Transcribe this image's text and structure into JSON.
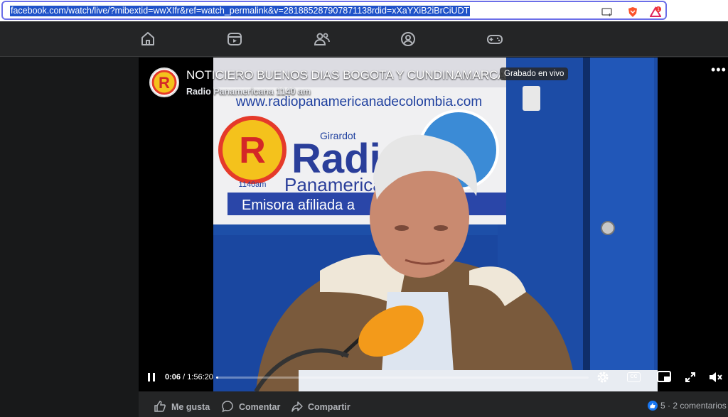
{
  "browser": {
    "url": "facebook.com/watch/live/?mibextid=wwXIfr&ref=watch_permalink&v=281885287907871138rdid=xXaYXiB2iBrCiUDT",
    "icons": [
      "install-app-icon",
      "brave-shield-icon",
      "brave-rewards-icon"
    ],
    "rewards_badge": "1"
  },
  "nav": {
    "items": [
      {
        "name": "home-icon"
      },
      {
        "name": "video-icon"
      },
      {
        "name": "friends-icon"
      },
      {
        "name": "profile-icon"
      },
      {
        "name": "gaming-icon"
      }
    ]
  },
  "video": {
    "title": "NOTICIERO BUENOS DIAS BOGOTA Y CUNDINAMARCA",
    "badge": "Grabado en vivo",
    "channel": "Radio Panamericana 1140 am",
    "more": "•••",
    "poster": {
      "url_text": "www.radiopanamericanadecolombia.com",
      "city": "Girardot",
      "brand_line1": "Radio",
      "brand_line2": "Panamericana",
      "frequency": "1140am",
      "footer": "Emisora afiliada a"
    }
  },
  "player": {
    "current_time": "0:06",
    "separator": " / ",
    "duration": "1:56:20",
    "progress": 0.001,
    "cc_label": "CC"
  },
  "actions": {
    "like": "Me gusta",
    "comment": "Comentar",
    "share": "Compartir",
    "reactions_count": "5",
    "comments": "2 comentarios",
    "dot": "·"
  },
  "colors": {
    "accent": "#1877f2",
    "background": "#18191a",
    "nav": "#242526"
  }
}
